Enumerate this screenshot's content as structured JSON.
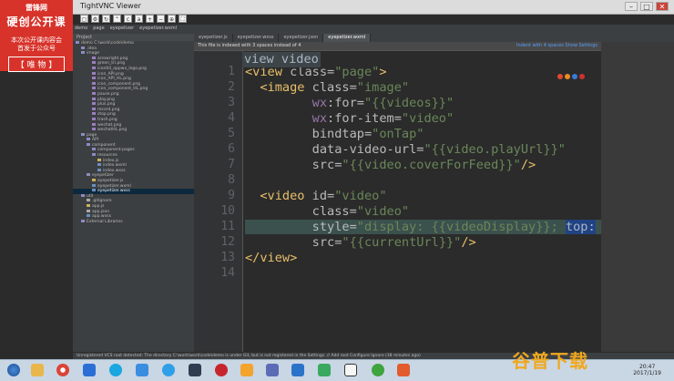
{
  "window": {
    "title": "TightVNC Viewer"
  },
  "banner": {
    "site": "雷锋网",
    "title": "硬创公开课",
    "note_line1": "本次公开课内容会",
    "note_line2": "首发于公众号",
    "button": "【 唯 物 】"
  },
  "breadcrumb": [
    "demo",
    "page",
    "eyepetizer",
    "eyepetizer.wxml"
  ],
  "tabs": [
    "eyepetizer.js",
    "eyepetizer.wxss",
    "eyepetizer.json",
    "eyepetizer.wxml"
  ],
  "notice": {
    "text": "This file is indexed with 3 spaces instead of 4",
    "links": "Indent with 4 spaces   Show Settings"
  },
  "project": {
    "header": "Project",
    "root": "demo  C:\\work\\code\\demo",
    "items": [
      {
        "label": ".idea",
        "color": "#8b8bc2",
        "indent": 1
      },
      {
        "label": "image",
        "color": "#8b8bc2",
        "indent": 1
      },
      {
        "label": "arrowright.png",
        "color": "#9a7fbf",
        "indent": 3
      },
      {
        "label": "green_tri.png",
        "color": "#9a7fbf",
        "indent": 3
      },
      {
        "label": "icon64_appwx_logo.png",
        "color": "#9a7fbf",
        "indent": 3
      },
      {
        "label": "icon_API.png",
        "color": "#9a7fbf",
        "indent": 3
      },
      {
        "label": "icon_API_HL.png",
        "color": "#9a7fbf",
        "indent": 3
      },
      {
        "label": "icon_component.png",
        "color": "#9a7fbf",
        "indent": 3
      },
      {
        "label": "icon_component_HL.png",
        "color": "#9a7fbf",
        "indent": 3
      },
      {
        "label": "pause.png",
        "color": "#9a7fbf",
        "indent": 3
      },
      {
        "label": "play.png",
        "color": "#9a7fbf",
        "indent": 3
      },
      {
        "label": "plus.png",
        "color": "#9a7fbf",
        "indent": 3
      },
      {
        "label": "record.png",
        "color": "#9a7fbf",
        "indent": 3
      },
      {
        "label": "stop.png",
        "color": "#9a7fbf",
        "indent": 3
      },
      {
        "label": "trash.png",
        "color": "#9a7fbf",
        "indent": 3
      },
      {
        "label": "wechat.png",
        "color": "#9a7fbf",
        "indent": 3
      },
      {
        "label": "wechatHL.png",
        "color": "#9a7fbf",
        "indent": 3
      },
      {
        "label": "page",
        "color": "#8b8bc2",
        "indent": 1
      },
      {
        "label": "API",
        "color": "#8b8bc2",
        "indent": 2
      },
      {
        "label": "component",
        "color": "#8b8bc2",
        "indent": 2
      },
      {
        "label": "component-pages",
        "color": "#8b8bc2",
        "indent": 3
      },
      {
        "label": "resources",
        "color": "#8b8bc2",
        "indent": 3
      },
      {
        "label": "index.js",
        "color": "#c9b15c",
        "indent": 4
      },
      {
        "label": "index.wxml",
        "color": "#6a8fbf",
        "indent": 4
      },
      {
        "label": "index.wxss",
        "color": "#6a8fbf",
        "indent": 4
      },
      {
        "label": "eyepetizer",
        "color": "#8b8bc2",
        "indent": 2
      },
      {
        "label": "eyepetizer.js",
        "color": "#c9b15c",
        "indent": 3
      },
      {
        "label": "eyepetizer.wxml",
        "color": "#6a8fbf",
        "indent": 3
      },
      {
        "label": "eyepetizer.wxss",
        "color": "#6a8fbf",
        "indent": 3,
        "selected": true
      },
      {
        "label": "util",
        "color": "#8b8bc2",
        "indent": 1
      },
      {
        "label": ".gitignore",
        "color": "#aaaaaa",
        "indent": 2
      },
      {
        "label": "app.js",
        "color": "#c9b15c",
        "indent": 2
      },
      {
        "label": "app.json",
        "color": "#aaaaaa",
        "indent": 2
      },
      {
        "label": "app.wxss",
        "color": "#6a8fbf",
        "indent": 2
      },
      {
        "label": "External Libraries",
        "color": "#8b8bc2",
        "indent": 1
      }
    ]
  },
  "editor": {
    "hint": "view video",
    "line_numbers": [
      "1",
      "2",
      "3",
      "4",
      "5",
      "6",
      "7",
      "8",
      "9",
      "10",
      "11",
      "12",
      "13",
      "14"
    ]
  },
  "status": {
    "text": "Unregistered VCS root detected: The directory C:\\work\\work\\code\\demo is under Git, but is not registered in the Settings. // Add root  Configure  Ignore (38 minutes ago)"
  },
  "clock": {
    "time": "20:47",
    "date": "2017/1/19"
  },
  "watermark": "谷普下载"
}
